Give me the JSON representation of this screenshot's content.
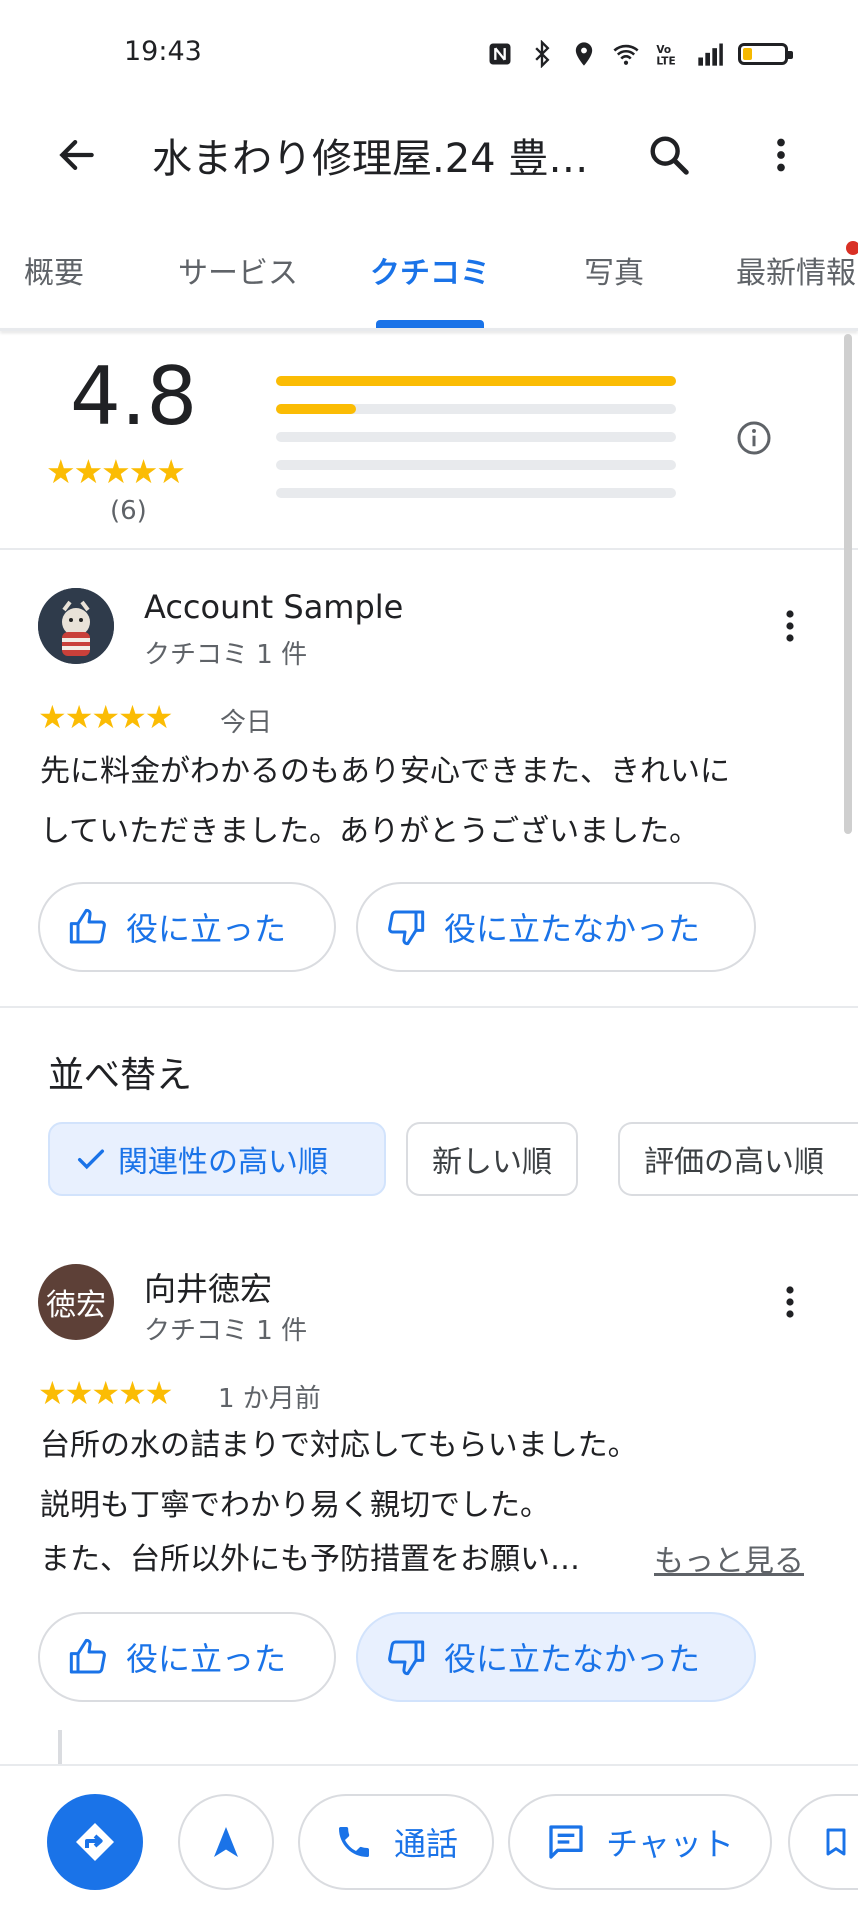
{
  "status_bar": {
    "time": "19:43",
    "icons": [
      "nfc-icon",
      "bluetooth-icon",
      "location-icon",
      "wifi-icon",
      "volte-icon",
      "signal-icon",
      "battery-icon"
    ]
  },
  "header": {
    "title": "水まわり修理屋.24 豊…",
    "back_icon": "arrow-left-icon",
    "search_icon": "search-icon",
    "more_icon": "more-vertical-icon"
  },
  "tabs": [
    {
      "label": "概要"
    },
    {
      "label": "サービス"
    },
    {
      "label": "クチコミ",
      "active": true
    },
    {
      "label": "写真"
    },
    {
      "label": "最新情報"
    }
  ],
  "rating_summary": {
    "average": "4.8",
    "stars": "★★★★★",
    "count": "(6)",
    "distribution_fractions": [
      1.0,
      0.2,
      0.0,
      0.0,
      0.0
    ]
  },
  "reviews": [
    {
      "avatar_text": "",
      "name": "Account Sample",
      "subtitle": "クチコミ 1 件",
      "stars": "★★★★★",
      "time": "今日",
      "lines": [
        "先に料金がわかるのもあり安心できまた、きれいに",
        "していただきました。ありがとうございました。"
      ],
      "helpful_label": "役に立った",
      "not_helpful_label": "役に立たなかった"
    },
    {
      "avatar_text": "徳宏",
      "name": "向井徳宏",
      "subtitle": "クチコミ 1 件",
      "stars": "★★★★★",
      "time": "1 か月前",
      "lines": [
        "台所の水の詰まりで対応してもらいました。",
        "説明も丁寧でわかり易く親切でした。",
        "また、台所以外にも予防措置をお願い…"
      ],
      "more_label": "もっと見る",
      "helpful_label": "役に立った",
      "not_helpful_label": "役に立たなかった"
    }
  ],
  "sort": {
    "title": "並べ替え",
    "options": [
      {
        "label": "関連性の高い順",
        "selected": true
      },
      {
        "label": "新しい順"
      },
      {
        "label": "評価の高い順"
      }
    ]
  },
  "bottom_bar": {
    "call_label": "通話",
    "chat_label": "チャット"
  },
  "colors": {
    "accent": "#1a73e8",
    "star": "#fbbc04",
    "notification_dot": "#d93025",
    "avatar2_bg": "#5d4037"
  }
}
